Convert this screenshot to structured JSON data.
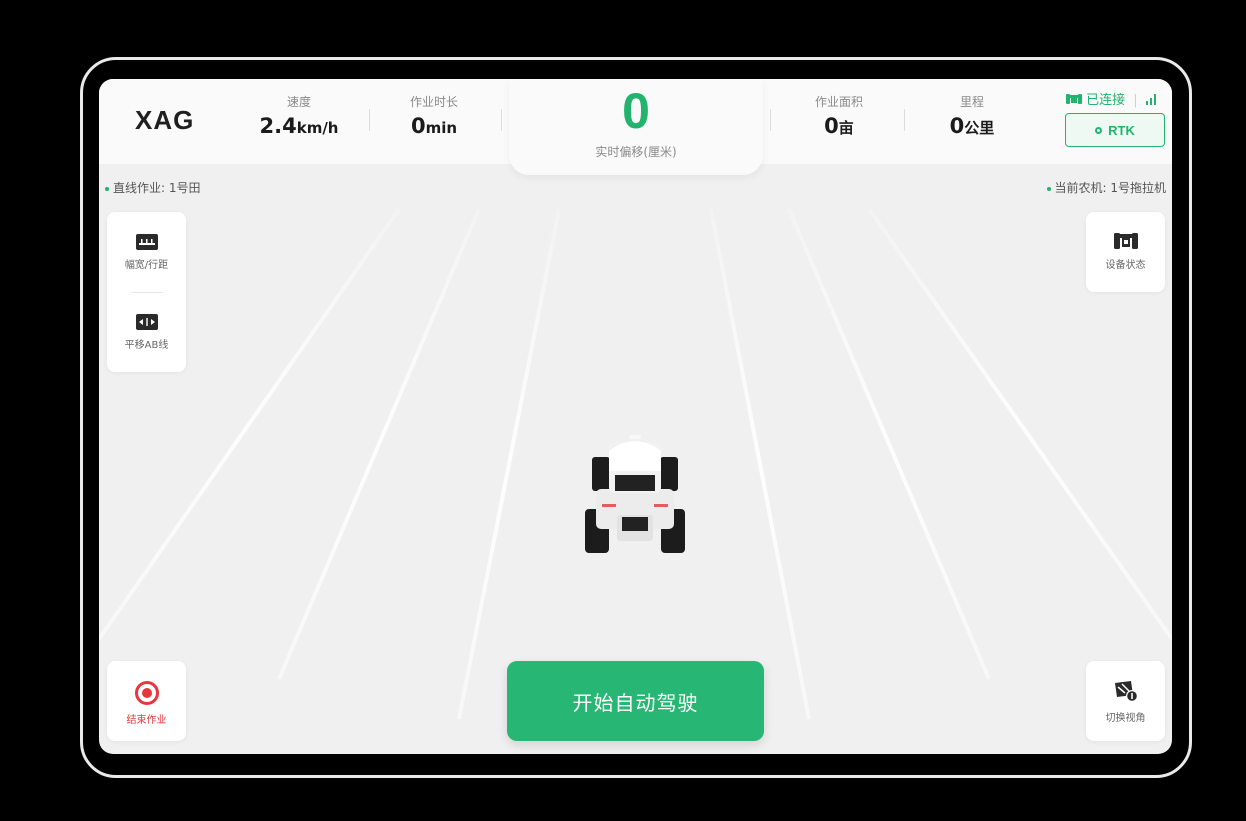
{
  "header": {
    "logo": "XAG",
    "speed": {
      "label": "速度",
      "value": "2.4",
      "unit": "km/h"
    },
    "duration": {
      "label": "作业时长",
      "value": "0",
      "unit": "min"
    },
    "offset": {
      "value": "0",
      "label": "实时偏移(厘米)"
    },
    "area": {
      "label": "作业面积",
      "value": "0",
      "unit": "亩"
    },
    "mileage": {
      "label": "里程",
      "value": "0",
      "unit": "公里"
    },
    "connection": {
      "status": "已连接",
      "icon": "tractor-icon",
      "signal_icon": "signal-icon"
    },
    "rtk_label": "RTK"
  },
  "tags": {
    "field_job": "直线作业: 1号田",
    "current_machine": "当前农机: 1号拖拉机"
  },
  "tools": {
    "width_spacing": {
      "label": "幅宽/行距",
      "icon": "ruler-icon"
    },
    "shift_ab": {
      "label": "平移AB线",
      "icon": "shift-arrows-icon"
    },
    "device_status": {
      "label": "设备状态",
      "icon": "tractor-icon"
    },
    "end_job": {
      "label": "结束作业",
      "icon": "target-icon"
    },
    "switch_view": {
      "label": "切换视角",
      "icon": "view-switch-icon"
    }
  },
  "start_button": "开始自动驾驶",
  "colors": {
    "accent": "#22b36d",
    "guide_line": "#2f86e6",
    "danger": "#e8363f",
    "background": "#f0f0f0"
  }
}
